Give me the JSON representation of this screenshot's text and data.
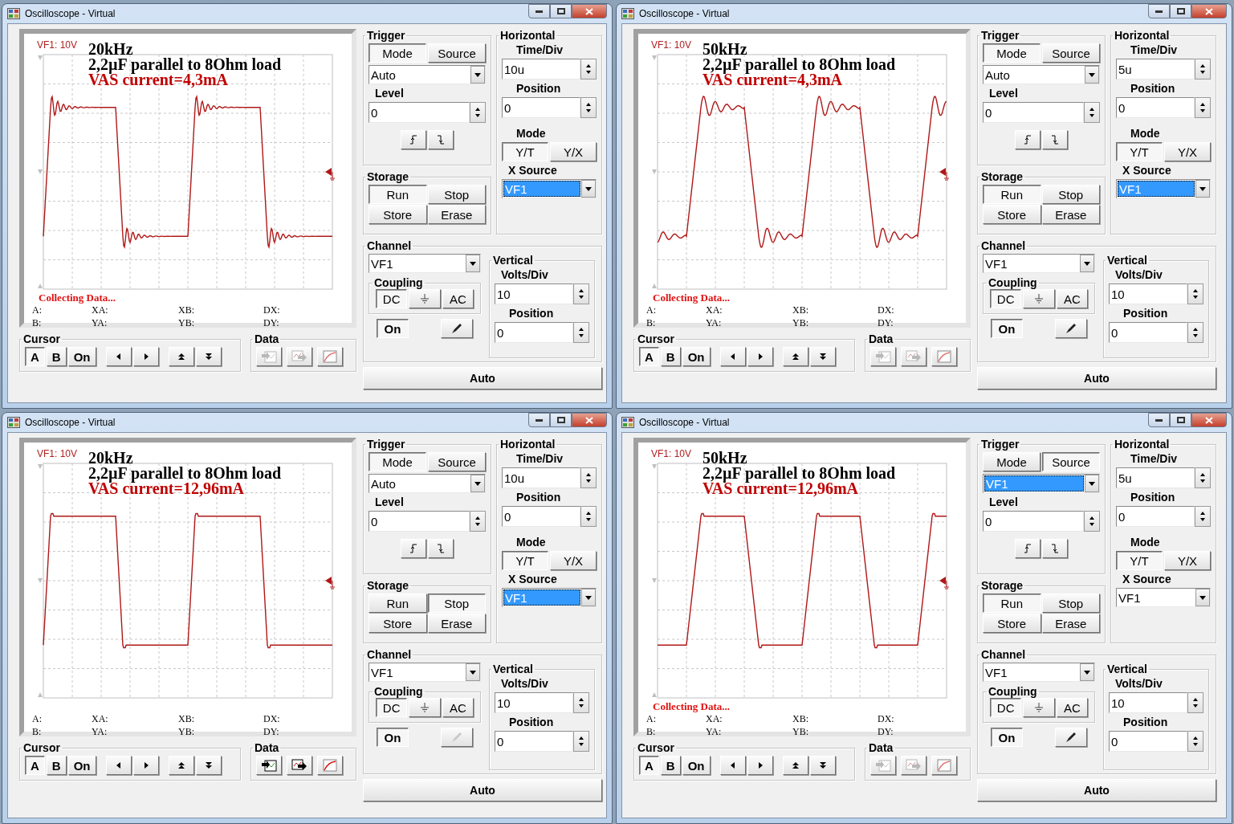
{
  "windows": [
    {
      "title": "Oscilloscope - Virtual",
      "scope": {
        "channel_label": "VF1: 10V",
        "annotations": [
          {
            "text": "20kHz",
            "color": "#000000"
          },
          {
            "text": "2,2µF parallel to 8Ohm load",
            "color": "#000000"
          },
          {
            "text": "VAS current=4,3mA",
            "color": "#c00000"
          }
        ],
        "waveform": {
          "ringing": true
        },
        "status": "Collecting Data...",
        "readouts": [
          "A:",
          "XA:",
          "XB:",
          "DX:",
          "B:",
          "YA:",
          "YB:",
          "DY:"
        ]
      },
      "cursor": {
        "label": "Cursor",
        "buttons": [
          {
            "label": "A",
            "selected": true
          },
          {
            "label": "B",
            "selected": false
          },
          {
            "label": "On",
            "selected": false
          }
        ]
      },
      "data": {
        "label": "Data",
        "disabled": true
      },
      "trigger": {
        "label": "Trigger",
        "tabs": [
          {
            "label": "Mode",
            "selected": true
          },
          {
            "label": "Source",
            "selected": false
          }
        ],
        "dropdown": {
          "value": "Auto",
          "highlighted": false
        },
        "level_field": {
          "label": "Level",
          "value": "0"
        }
      },
      "storage": {
        "label": "Storage",
        "buttons": [
          {
            "label": "Run",
            "selected": true
          },
          {
            "label": "Stop",
            "selected": false
          },
          {
            "label": "Store",
            "selected": false
          },
          {
            "label": "Erase",
            "selected": false
          }
        ]
      },
      "horizontal": {
        "label": "Horizontal",
        "time_div": {
          "label": "Time/Div",
          "value": "10u"
        },
        "position": {
          "label": "Position",
          "value": "0"
        },
        "mode": {
          "label": "Mode",
          "options": [
            {
              "label": "Y/T",
              "selected": true
            },
            {
              "label": "Y/X",
              "selected": false
            }
          ]
        },
        "x_source": {
          "label": "X Source",
          "value": "VF1",
          "highlighted": true
        }
      },
      "channel": {
        "label": "Channel",
        "dropdown": {
          "value": "VF1",
          "highlighted": false
        },
        "coupling": {
          "label": "Coupling",
          "options": [
            {
              "kind": "text",
              "label": "DC",
              "selected": true
            },
            {
              "kind": "ground",
              "selected": false
            },
            {
              "kind": "text",
              "label": "AC",
              "selected": false
            }
          ]
        },
        "on_button": {
          "label": "On",
          "selected": true
        },
        "probe_button": {
          "disabled": false
        }
      },
      "vertical": {
        "label": "Vertical",
        "volts_div": {
          "label": "Volts/Div",
          "value": "10"
        },
        "position": {
          "label": "Position",
          "value": "0"
        }
      },
      "auto_button": "Auto"
    },
    {
      "title": "Oscilloscope - Virtual",
      "scope": {
        "channel_label": "VF1: 10V",
        "annotations": [
          {
            "text": "50kHz",
            "color": "#000000"
          },
          {
            "text": "2,2µF parallel to 8Ohm load",
            "color": "#000000"
          },
          {
            "text": "VAS current=4,3mA",
            "color": "#c00000"
          }
        ],
        "waveform": {
          "ringing": true
        },
        "status": "Collecting Data...",
        "readouts": [
          "A:",
          "XA:",
          "XB:",
          "DX:",
          "B:",
          "YA:",
          "YB:",
          "DY:"
        ]
      },
      "cursor": {
        "label": "Cursor",
        "buttons": [
          {
            "label": "A",
            "selected": true
          },
          {
            "label": "B",
            "selected": false
          },
          {
            "label": "On",
            "selected": false
          }
        ]
      },
      "data": {
        "label": "Data",
        "disabled": true
      },
      "trigger": {
        "label": "Trigger",
        "tabs": [
          {
            "label": "Mode",
            "selected": true
          },
          {
            "label": "Source",
            "selected": false
          }
        ],
        "dropdown": {
          "value": "Auto",
          "highlighted": false
        },
        "level_field": {
          "label": "Level",
          "value": "0"
        }
      },
      "storage": {
        "label": "Storage",
        "buttons": [
          {
            "label": "Run",
            "selected": true
          },
          {
            "label": "Stop",
            "selected": false
          },
          {
            "label": "Store",
            "selected": false
          },
          {
            "label": "Erase",
            "selected": false
          }
        ]
      },
      "horizontal": {
        "label": "Horizontal",
        "time_div": {
          "label": "Time/Div",
          "value": "5u"
        },
        "position": {
          "label": "Position",
          "value": "0"
        },
        "mode": {
          "label": "Mode",
          "options": [
            {
              "label": "Y/T",
              "selected": true
            },
            {
              "label": "Y/X",
              "selected": false
            }
          ]
        },
        "x_source": {
          "label": "X Source",
          "value": "VF1",
          "highlighted": true
        }
      },
      "channel": {
        "label": "Channel",
        "dropdown": {
          "value": "VF1",
          "highlighted": false
        },
        "coupling": {
          "label": "Coupling",
          "options": [
            {
              "kind": "text",
              "label": "DC",
              "selected": true
            },
            {
              "kind": "ground",
              "selected": false
            },
            {
              "kind": "text",
              "label": "AC",
              "selected": false
            }
          ]
        },
        "on_button": {
          "label": "On",
          "selected": true
        },
        "probe_button": {
          "disabled": false
        }
      },
      "vertical": {
        "label": "Vertical",
        "volts_div": {
          "label": "Volts/Div",
          "value": "10"
        },
        "position": {
          "label": "Position",
          "value": "0"
        }
      },
      "auto_button": "Auto"
    },
    {
      "title": "Oscilloscope - Virtual",
      "scope": {
        "channel_label": "VF1: 10V",
        "annotations": [
          {
            "text": "20kHz",
            "color": "#000000"
          },
          {
            "text": "2,2µF parallel to 8Ohm load",
            "color": "#000000"
          },
          {
            "text": "VAS current=12,96mA",
            "color": "#c00000"
          }
        ],
        "waveform": {
          "ringing": false
        },
        "readouts": [
          "A:",
          "XA:",
          "XB:",
          "DX:",
          "B:",
          "YA:",
          "YB:",
          "DY:"
        ]
      },
      "cursor": {
        "label": "Cursor",
        "buttons": [
          {
            "label": "A",
            "selected": true
          },
          {
            "label": "B",
            "selected": false
          },
          {
            "label": "On",
            "selected": false
          }
        ]
      },
      "data": {
        "label": "Data",
        "disabled": false
      },
      "trigger": {
        "label": "Trigger",
        "tabs": [
          {
            "label": "Mode",
            "selected": true
          },
          {
            "label": "Source",
            "selected": false
          }
        ],
        "dropdown": {
          "value": "Auto",
          "highlighted": false
        },
        "level_field": {
          "label": "Level",
          "value": "0"
        }
      },
      "storage": {
        "label": "Storage",
        "buttons": [
          {
            "label": "Run",
            "selected": false
          },
          {
            "label": "Stop",
            "selected": true
          },
          {
            "label": "Store",
            "selected": false
          },
          {
            "label": "Erase",
            "selected": false
          }
        ]
      },
      "horizontal": {
        "label": "Horizontal",
        "time_div": {
          "label": "Time/Div",
          "value": "10u"
        },
        "position": {
          "label": "Position",
          "value": "0"
        },
        "mode": {
          "label": "Mode",
          "options": [
            {
              "label": "Y/T",
              "selected": true
            },
            {
              "label": "Y/X",
              "selected": false
            }
          ]
        },
        "x_source": {
          "label": "X Source",
          "value": "VF1",
          "highlighted": true
        }
      },
      "channel": {
        "label": "Channel",
        "dropdown": {
          "value": "VF1",
          "highlighted": false
        },
        "coupling": {
          "label": "Coupling",
          "options": [
            {
              "kind": "text",
              "label": "DC",
              "selected": true
            },
            {
              "kind": "ground",
              "selected": false
            },
            {
              "kind": "text",
              "label": "AC",
              "selected": false
            }
          ]
        },
        "on_button": {
          "label": "On",
          "selected": true
        },
        "probe_button": {
          "disabled": true
        }
      },
      "vertical": {
        "label": "Vertical",
        "volts_div": {
          "label": "Volts/Div",
          "value": "10"
        },
        "position": {
          "label": "Position",
          "value": "0"
        }
      },
      "auto_button": "Auto"
    },
    {
      "title": "Oscilloscope - Virtual",
      "scope": {
        "channel_label": "VF1: 10V",
        "annotations": [
          {
            "text": "50kHz",
            "color": "#000000"
          },
          {
            "text": "2,2µF parallel to 8Ohm load",
            "color": "#000000"
          },
          {
            "text": "VAS current=12,96mA",
            "color": "#c00000"
          }
        ],
        "waveform": {
          "ringing": false
        },
        "status": "Collecting Data...",
        "readouts": [
          "A:",
          "XA:",
          "XB:",
          "DX:",
          "B:",
          "YA:",
          "YB:",
          "DY:"
        ]
      },
      "cursor": {
        "label": "Cursor",
        "buttons": [
          {
            "label": "A",
            "selected": true
          },
          {
            "label": "B",
            "selected": false
          },
          {
            "label": "On",
            "selected": false
          }
        ]
      },
      "data": {
        "label": "Data",
        "disabled": true
      },
      "trigger": {
        "label": "Trigger",
        "tabs": [
          {
            "label": "Mode",
            "selected": false
          },
          {
            "label": "Source",
            "selected": true
          }
        ],
        "dropdown": {
          "value": "VF1",
          "highlighted": true
        },
        "level_field": {
          "label": "Level",
          "value": "0"
        }
      },
      "storage": {
        "label": "Storage",
        "buttons": [
          {
            "label": "Run",
            "selected": true
          },
          {
            "label": "Stop",
            "selected": false
          },
          {
            "label": "Store",
            "selected": false
          },
          {
            "label": "Erase",
            "selected": false
          }
        ]
      },
      "horizontal": {
        "label": "Horizontal",
        "time_div": {
          "label": "Time/Div",
          "value": "5u"
        },
        "position": {
          "label": "Position",
          "value": "0"
        },
        "mode": {
          "label": "Mode",
          "options": [
            {
              "label": "Y/T",
              "selected": true
            },
            {
              "label": "Y/X",
              "selected": false
            }
          ]
        },
        "x_source": {
          "label": "X Source",
          "value": "VF1",
          "highlighted": false
        }
      },
      "channel": {
        "label": "Channel",
        "dropdown": {
          "value": "VF1",
          "highlighted": false
        },
        "coupling": {
          "label": "Coupling",
          "options": [
            {
              "kind": "text",
              "label": "DC",
              "selected": true
            },
            {
              "kind": "ground",
              "selected": false
            },
            {
              "kind": "text",
              "label": "AC",
              "selected": false
            }
          ]
        },
        "on_button": {
          "label": "On",
          "selected": true
        },
        "probe_button": {
          "disabled": false
        }
      },
      "vertical": {
        "label": "Vertical",
        "volts_div": {
          "label": "Volts/Div",
          "value": "10"
        },
        "position": {
          "label": "Position",
          "value": "0"
        }
      },
      "auto_button": "Auto"
    }
  ]
}
